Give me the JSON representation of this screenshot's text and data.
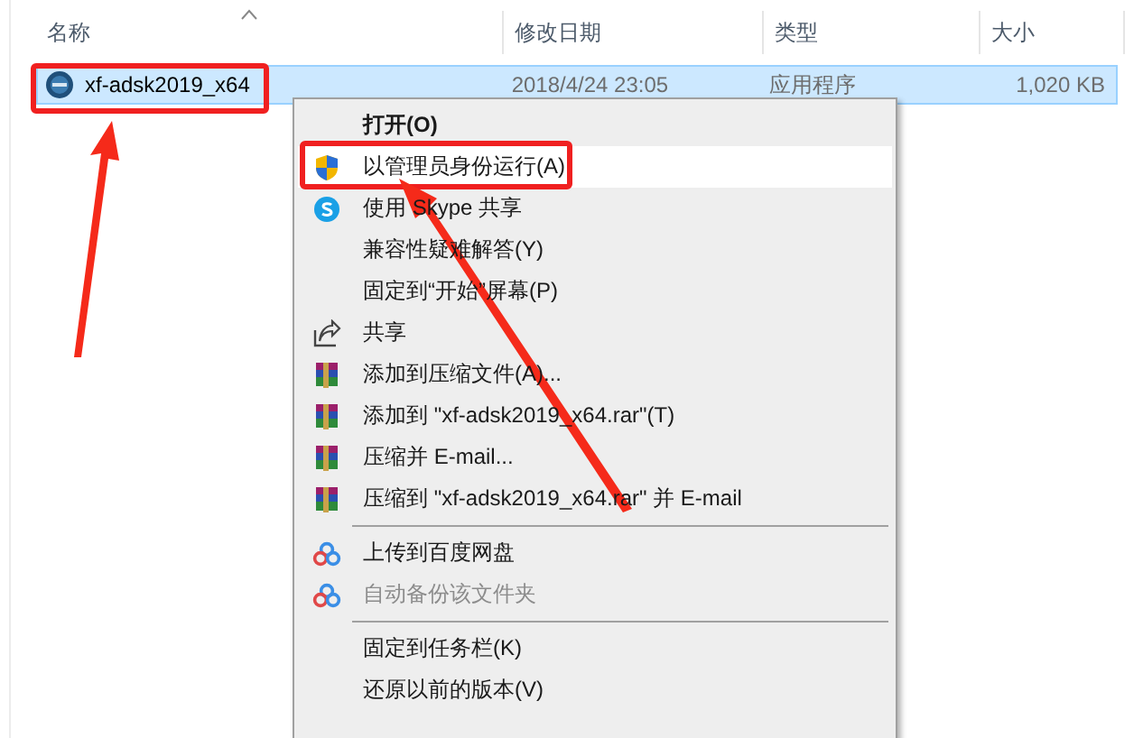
{
  "columns": [
    {
      "label": "名称"
    },
    {
      "label": "修改日期"
    },
    {
      "label": "类型"
    },
    {
      "label": "大小"
    }
  ],
  "files": [
    {
      "name": "xf-adsk2019_x64",
      "modified": "2018/4/24 23:05",
      "type": "应用程序",
      "size": "1,020 KB",
      "selected": true
    }
  ],
  "context_menu": {
    "groups": [
      [
        {
          "label": "打开(O)",
          "default": true,
          "selected": false,
          "disabled": false
        },
        {
          "label": "以管理员身份运行(A)",
          "default": false,
          "selected": true,
          "disabled": false
        },
        {
          "label": "使用 Skype 共享",
          "default": false,
          "selected": false,
          "disabled": false
        },
        {
          "label": "兼容性疑难解答(Y)",
          "default": false,
          "selected": false,
          "disabled": false
        },
        {
          "label": "固定到“开始”屏幕(P)",
          "default": false,
          "selected": false,
          "disabled": false
        },
        {
          "label": "共享",
          "default": false,
          "selected": false,
          "disabled": false
        },
        {
          "label": "添加到压缩文件(A)...",
          "default": false,
          "selected": false,
          "disabled": false
        },
        {
          "label": "添加到 \"xf-adsk2019_x64.rar\"(T)",
          "default": false,
          "selected": false,
          "disabled": false
        },
        {
          "label": "压缩并 E-mail...",
          "default": false,
          "selected": false,
          "disabled": false
        },
        {
          "label": "压缩到 \"xf-adsk2019_x64.rar\" 并 E-mail",
          "default": false,
          "selected": false,
          "disabled": false
        }
      ],
      [
        {
          "label": "上传到百度网盘",
          "default": false,
          "selected": false,
          "disabled": false
        },
        {
          "label": "自动备份该文件夹",
          "default": false,
          "selected": false,
          "disabled": true
        }
      ],
      [
        {
          "label": "固定到任务栏(K)",
          "default": false,
          "selected": false,
          "disabled": false
        },
        {
          "label": "还原以前的版本(V)",
          "default": false,
          "selected": false,
          "disabled": false
        }
      ]
    ]
  }
}
